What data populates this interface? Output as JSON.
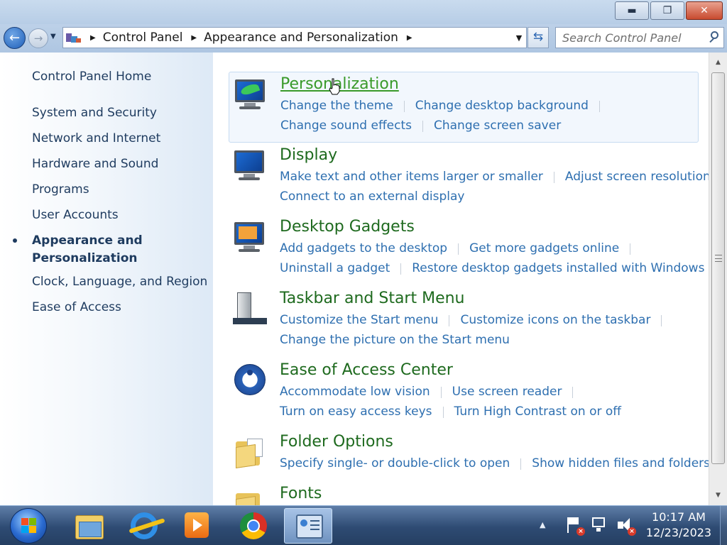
{
  "window": {
    "minimize_label": "▬",
    "maximize_label": "❐",
    "close_label": "✕"
  },
  "navigation": {
    "back_glyph": "←",
    "forward_glyph": "→",
    "breadcrumbs": [
      "Control Panel",
      "Appearance and Personalization"
    ],
    "refresh_glyph": "⇆",
    "search_placeholder": "Search Control Panel"
  },
  "sidebar": {
    "home": "Control Panel Home",
    "items": [
      "System and Security",
      "Network and Internet",
      "Hardware and Sound",
      "Programs",
      "User Accounts",
      "Appearance and",
      "Personalization",
      "Clock, Language, and Region",
      "Ease of Access"
    ],
    "current_item": "Appearance and Personalization"
  },
  "categories": [
    {
      "title": "Personalization",
      "icon": "personalization-icon",
      "lines": [
        [
          "Change the theme",
          "Change desktop background"
        ],
        [
          "Change sound effects",
          "Change screen saver"
        ]
      ]
    },
    {
      "title": "Display",
      "icon": "display-icon",
      "lines": [
        [
          "Make text and other items larger or smaller",
          "Adjust screen resolution"
        ],
        [
          "Connect to an external display"
        ]
      ]
    },
    {
      "title": "Desktop Gadgets",
      "icon": "desktop-gadgets-icon",
      "lines": [
        [
          "Add gadgets to the desktop",
          "Get more gadgets online"
        ],
        [
          "Uninstall a gadget",
          "Restore desktop gadgets installed with Windows"
        ]
      ]
    },
    {
      "title": "Taskbar and Start Menu",
      "icon": "taskbar-icon",
      "lines": [
        [
          "Customize the Start menu",
          "Customize icons on the taskbar"
        ],
        [
          "Change the picture on the Start menu"
        ]
      ]
    },
    {
      "title": "Ease of Access Center",
      "icon": "ease-of-access-icon",
      "lines": [
        [
          "Accommodate low vision",
          "Use screen reader"
        ],
        [
          "Turn on easy access keys",
          "Turn High Contrast on or off"
        ]
      ]
    },
    {
      "title": "Folder Options",
      "icon": "folder-options-icon",
      "lines": [
        [
          "Specify single- or double-click to open",
          "Show hidden files and folders"
        ]
      ]
    },
    {
      "title": "Fonts",
      "icon": "fonts-icon",
      "lines": []
    }
  ],
  "taskbar": {
    "pinned": [
      "windows-explorer-icon",
      "internet-explorer-icon",
      "windows-media-player-icon",
      "chrome-icon",
      "control-panel-icon"
    ],
    "active": "control-panel-icon",
    "tray_arrow": "▲",
    "time": "10:17 AM",
    "date": "12/23/2023"
  }
}
